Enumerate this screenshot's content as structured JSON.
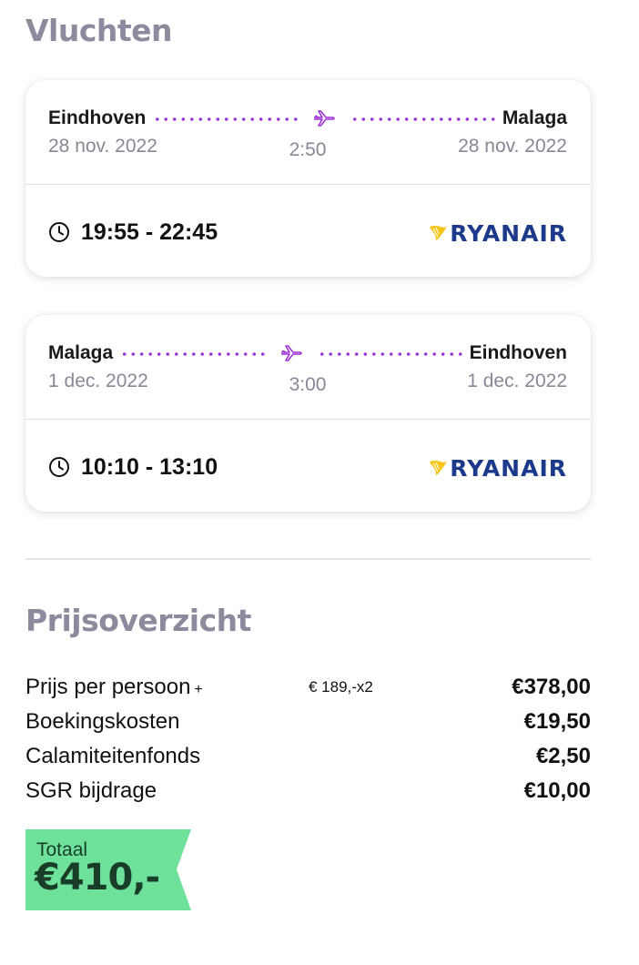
{
  "flights": {
    "section_title": "Vluchten",
    "outbound": {
      "from": "Eindhoven",
      "to": "Malaga",
      "departure_date": "28 nov. 2022",
      "arrival_date": "28 nov. 2022",
      "duration": "2:50",
      "times": "19:55 - 22:45",
      "airline": "RYANAIR"
    },
    "return": {
      "from": "Malaga",
      "to": "Eindhoven",
      "departure_date": "1 dec. 2022",
      "arrival_date": "1 dec. 2022",
      "duration": "3:00",
      "times": "10:10 - 13:10",
      "airline": "RYANAIR"
    }
  },
  "price_overview": {
    "section_title": "Prijsoverzicht",
    "rows": [
      {
        "label": "Prijs per persoon",
        "suffix": "+",
        "calc": "€ 189,-x2",
        "amount": "€378,00"
      },
      {
        "label": "Boekingskosten",
        "amount": "€19,50"
      },
      {
        "label": "Calamiteitenfonds",
        "amount": "€2,50"
      },
      {
        "label": "SGR bijdrage",
        "amount": "€10,00"
      }
    ],
    "total_label": "Totaal",
    "total_value": "€410,-"
  },
  "colors": {
    "accent_purple": "#9b2fd6",
    "title_gray": "#8c8a9c",
    "total_green": "#6ee29b",
    "ryanair_blue": "#1b3a8c"
  },
  "icons": {
    "plane": "plane-icon",
    "clock": "clock-icon",
    "airline_logo": "ryanair-harp-icon"
  }
}
